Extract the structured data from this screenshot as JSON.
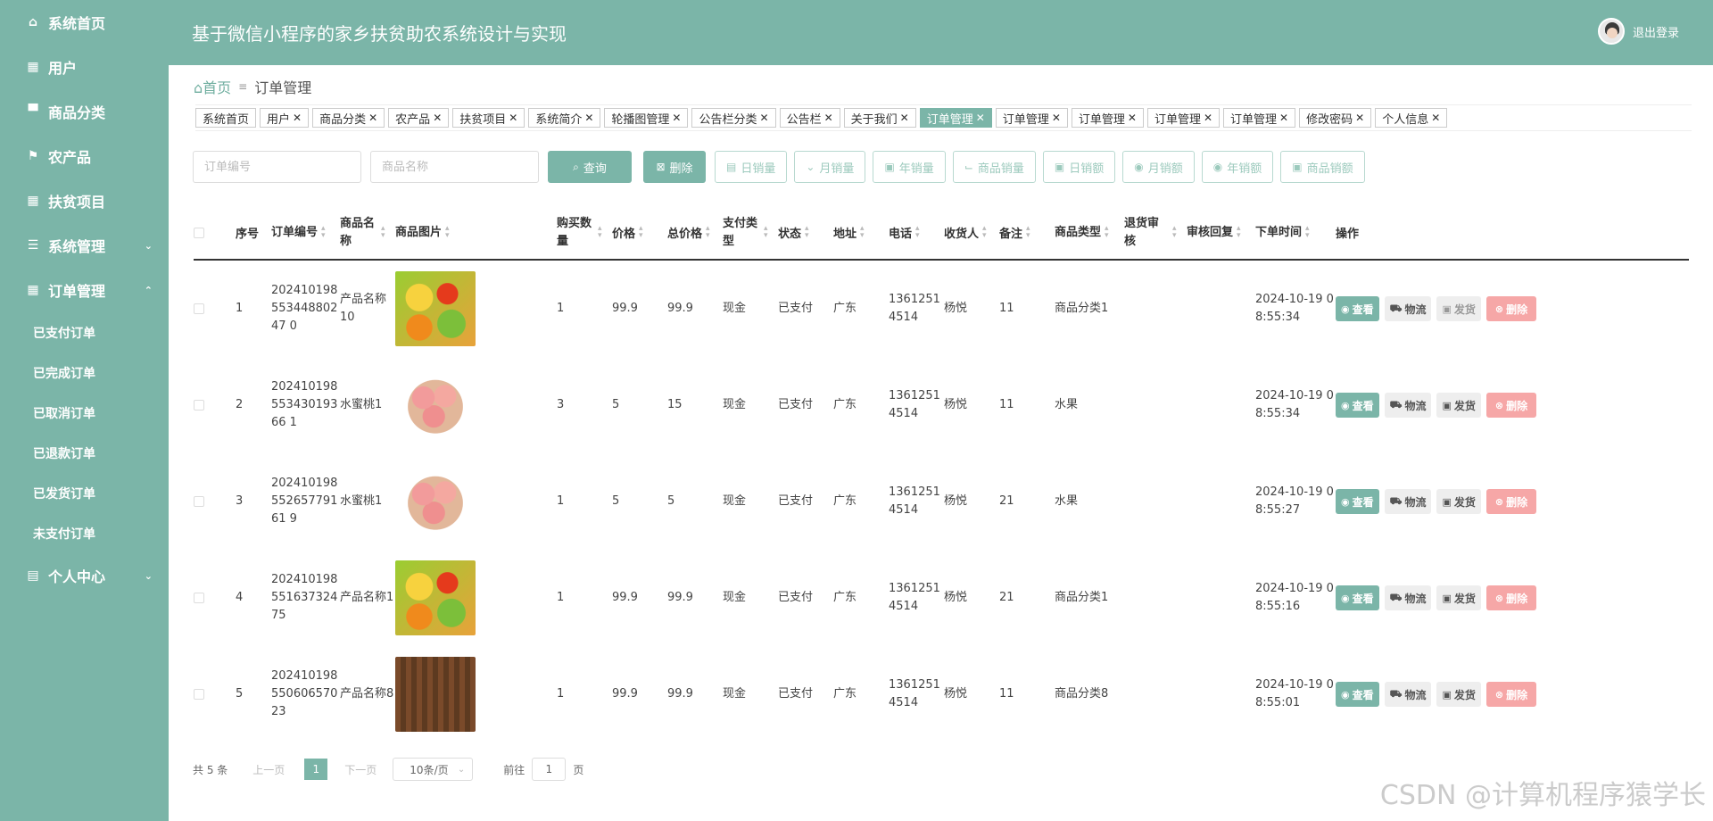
{
  "sidebar": {
    "items": [
      {
        "label": "系统首页",
        "icon": "home-icon",
        "glyph": "⌂"
      },
      {
        "label": "用户",
        "icon": "grid-icon",
        "glyph": "▦"
      },
      {
        "label": "商品分类",
        "icon": "monitor-icon",
        "glyph": "▀"
      },
      {
        "label": "农产品",
        "icon": "flag-icon",
        "glyph": "⚑"
      },
      {
        "label": "扶贫项目",
        "icon": "grid-icon",
        "glyph": "▦"
      },
      {
        "label": "系统管理",
        "icon": "sliders-icon",
        "glyph": "☰",
        "arrow": "⌄"
      },
      {
        "label": "订单管理",
        "icon": "grid-icon",
        "glyph": "▦",
        "arrow": "⌃"
      },
      {
        "label": "个人中心",
        "icon": "card-icon",
        "glyph": "▤",
        "arrow": "⌄"
      }
    ],
    "sub_items": [
      "已支付订单",
      "已完成订单",
      "已取消订单",
      "已退款订单",
      "已发货订单",
      "未支付订单"
    ]
  },
  "header": {
    "title": "基于微信小程序的家乡扶贫助农系统设计与实现",
    "logout": "退出登录"
  },
  "breadcrumb": {
    "home": "首页",
    "sep": "≡",
    "current": "订单管理"
  },
  "tags": [
    {
      "label": "系统首页",
      "closable": false
    },
    {
      "label": "用户",
      "closable": true
    },
    {
      "label": "商品分类",
      "closable": true
    },
    {
      "label": "农产品",
      "closable": true
    },
    {
      "label": "扶贫项目",
      "closable": true
    },
    {
      "label": "系统简介",
      "closable": true
    },
    {
      "label": "轮播图管理",
      "closable": true
    },
    {
      "label": "公告栏分类",
      "closable": true
    },
    {
      "label": "公告栏",
      "closable": true
    },
    {
      "label": "关于我们",
      "closable": true
    },
    {
      "label": "订单管理",
      "closable": true,
      "active": true
    },
    {
      "label": "订单管理",
      "closable": true
    },
    {
      "label": "订单管理",
      "closable": true
    },
    {
      "label": "订单管理",
      "closable": true
    },
    {
      "label": "订单管理",
      "closable": true
    },
    {
      "label": "修改密码",
      "closable": true
    },
    {
      "label": "个人信息",
      "closable": true
    }
  ],
  "toolbar": {
    "order_no_placeholder": "订单编号",
    "product_name_placeholder": "商品名称",
    "query": "查询",
    "delete": "删除",
    "stats": [
      "日销量",
      "月销量",
      "年销量",
      "商品销量",
      "日销额",
      "月销额",
      "年销额",
      "商品销额"
    ]
  },
  "table": {
    "headers": [
      "序号",
      "订单编号",
      "商品名称",
      "商品图片",
      "购买数量",
      "价格",
      "总价格",
      "支付类型",
      "状态",
      "地址",
      "电话",
      "收货人",
      "备注",
      "商品类型",
      "退货审核",
      "审核回复",
      "下单时间",
      "操作"
    ],
    "rows": [
      {
        "idx": "1",
        "order_no": "20241019855344880247 0",
        "name": "产品名称10",
        "img": "vegetables",
        "qty": "1",
        "price": "99.9",
        "total": "99.9",
        "pay": "现金",
        "status": "已支付",
        "addr": "广东",
        "phone": "13612514514",
        "receiver": "杨悦",
        "note": "11",
        "type": "商品分类1",
        "refund": "",
        "reply": "",
        "time": "2024-10-19 08:55:34"
      },
      {
        "idx": "2",
        "order_no": "20241019855343019366 1",
        "name": "水蜜桃1",
        "img": "peaches",
        "qty": "3",
        "price": "5",
        "total": "15",
        "pay": "现金",
        "status": "已支付",
        "addr": "广东",
        "phone": "13612514514",
        "receiver": "杨悦",
        "note": "11",
        "type": "水果",
        "refund": "",
        "reply": "",
        "time": "2024-10-19 08:55:34"
      },
      {
        "idx": "3",
        "order_no": "20241019855265779161 9",
        "name": "水蜜桃1",
        "img": "peaches",
        "qty": "1",
        "price": "5",
        "total": "5",
        "pay": "现金",
        "status": "已支付",
        "addr": "广东",
        "phone": "13612514514",
        "receiver": "杨悦",
        "note": "21",
        "type": "水果",
        "refund": "",
        "reply": "",
        "time": "2024-10-19 08:55:27"
      },
      {
        "idx": "4",
        "order_no": "20241019855163732475",
        "name": "产品名称1",
        "img": "vegetables",
        "qty": "1",
        "price": "99.9",
        "total": "99.9",
        "pay": "现金",
        "status": "已支付",
        "addr": "广东",
        "phone": "13612514514",
        "receiver": "杨悦",
        "note": "21",
        "type": "商品分类1",
        "refund": "",
        "reply": "",
        "time": "2024-10-19 08:55:16"
      },
      {
        "idx": "5",
        "order_no": "20241019855060657023",
        "name": "产品名称8",
        "img": "produce",
        "qty": "1",
        "price": "99.9",
        "total": "99.9",
        "pay": "现金",
        "status": "已支付",
        "addr": "广东",
        "phone": "13612514514",
        "receiver": "杨悦",
        "note": "11",
        "type": "商品分类8",
        "refund": "",
        "reply": "",
        "time": "2024-10-19 08:55:01"
      }
    ],
    "ops": {
      "view": "查看",
      "flow": "物流",
      "ship": "发货",
      "delete": "删除"
    }
  },
  "pager": {
    "total": "共 5 条",
    "prev": "上一页",
    "page": "1",
    "next": "下一页",
    "size": "10条/页",
    "goto": "前往",
    "goto_value": "1",
    "page_unit": "页"
  },
  "watermark": "CSDN @计算机程序猿学长",
  "colors": {
    "accent": "#7bb5a8",
    "danger": "#f6a7a7"
  }
}
